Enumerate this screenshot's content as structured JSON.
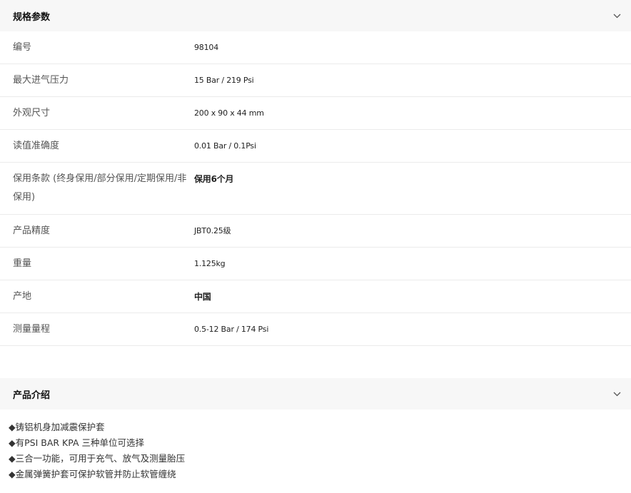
{
  "spec_section": {
    "title": "规格参数",
    "rows": [
      {
        "label": "编号",
        "value": "98104"
      },
      {
        "label": "最大进气压力",
        "value": "15 Bar / 219 Psi"
      },
      {
        "label": "外观尺寸",
        "value": "200 x 90 x 44 mm"
      },
      {
        "label": "读值准确度",
        "value": "0.01 Bar / 0.1Psi"
      },
      {
        "label": "保用条款 (终身保用/部分保用/定期保用/非保用)",
        "value": "保用6个月"
      },
      {
        "label": "产品精度",
        "value": "JBT0.25级"
      },
      {
        "label": "重量",
        "value": "1.125kg"
      },
      {
        "label": "产地",
        "value": "中国"
      },
      {
        "label": "测量量程",
        "value": "0.5-12 Bar / 174 Psi"
      }
    ]
  },
  "intro_section": {
    "title": "产品介绍",
    "items": [
      "◆铸铝机身加减震保护套",
      "◆有PSI BAR KPA 三种单位可选择",
      "◆三合一功能，可用于充气、放气及测量胎压",
      "◆金属弹簧护套可保护软管并防止软管缠绕"
    ]
  },
  "icons": {
    "expand": "chevron-down-icon"
  }
}
